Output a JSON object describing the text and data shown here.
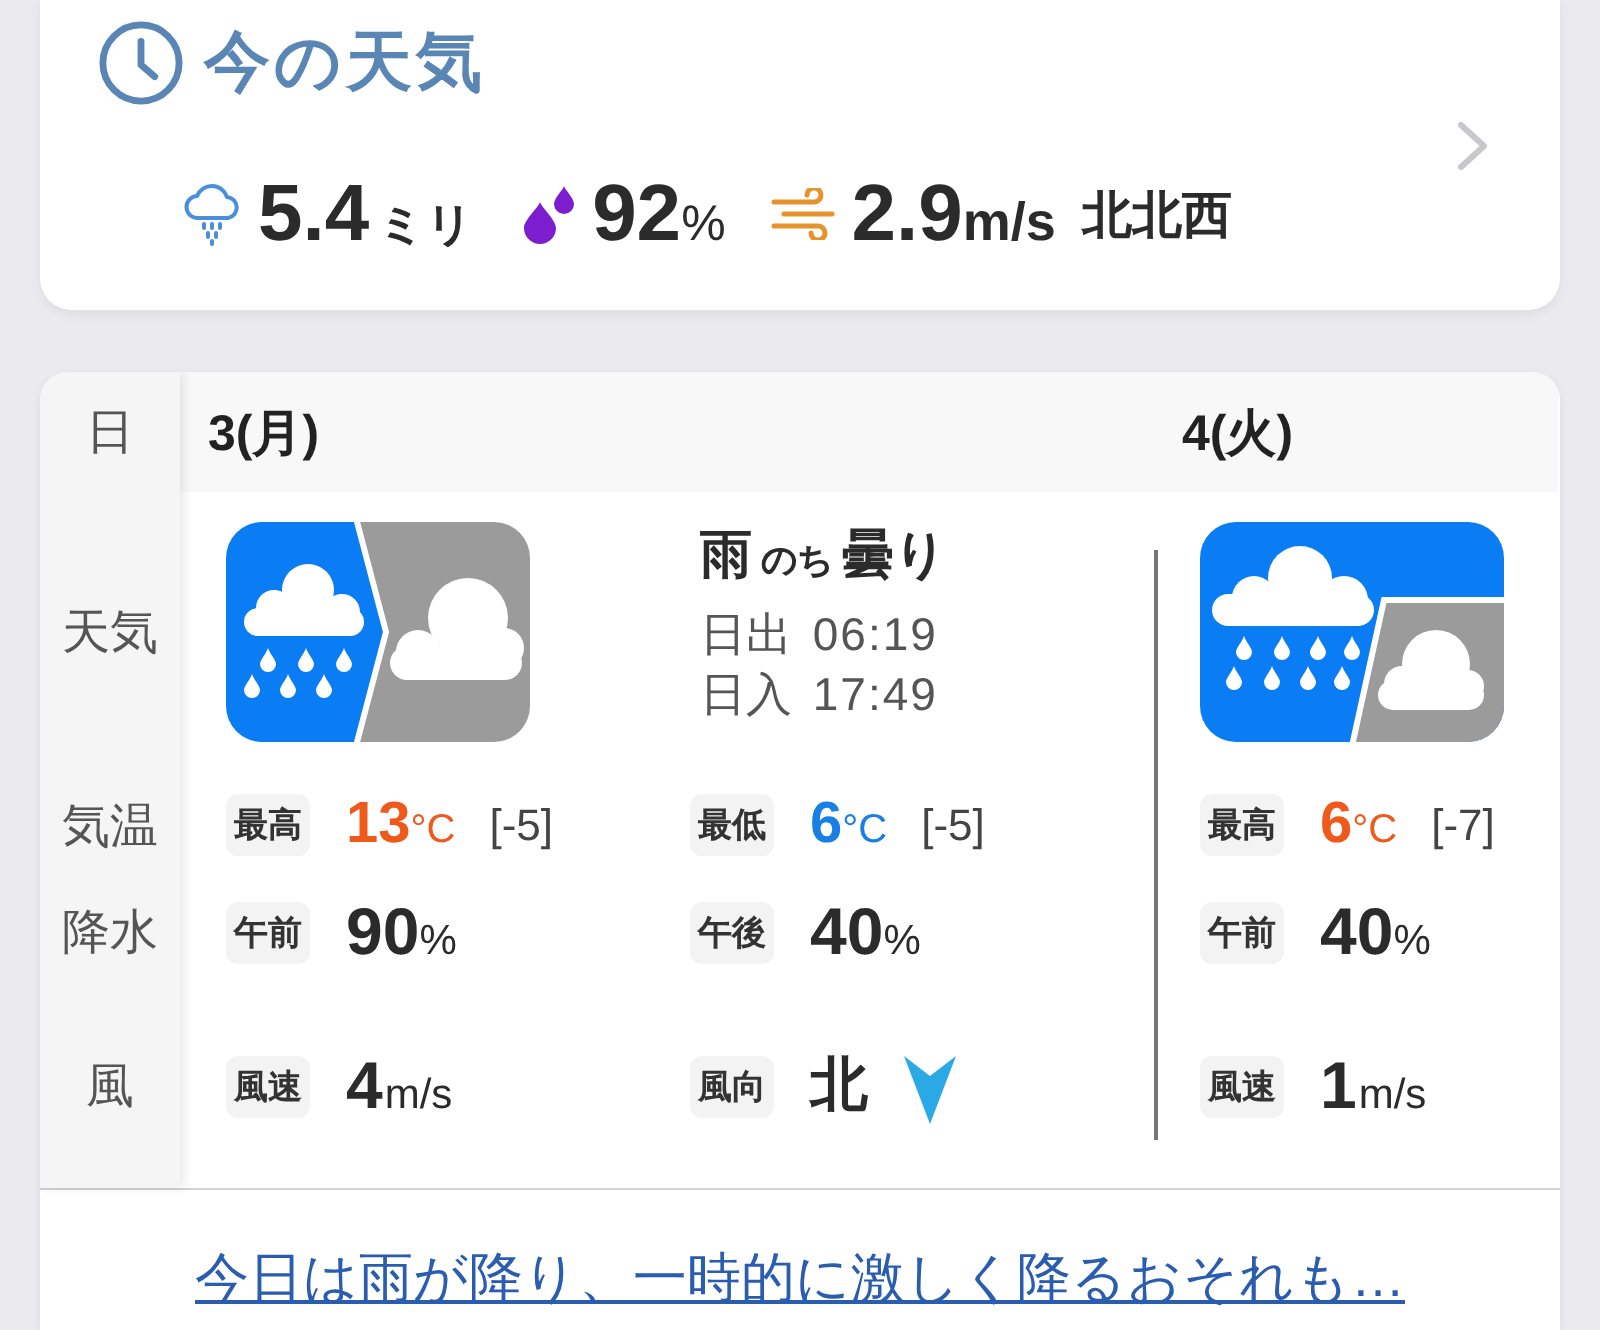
{
  "current_weather": {
    "title": "今の天気",
    "readings": [
      {
        "kind": "rain",
        "value": "5.4",
        "unit": "ミリ"
      },
      {
        "kind": "humidity",
        "value": "92",
        "unit": "%"
      },
      {
        "kind": "wind",
        "value": "2.9",
        "unit": "m/s",
        "direction": "北北西"
      }
    ]
  },
  "forecast": {
    "row_labels": [
      "日",
      "天気",
      "気温",
      "降水",
      "風"
    ],
    "days": [
      {
        "date": "3(月)",
        "kind": "rain_then_cloudy",
        "summary": [
          "雨",
          "のち",
          "曇り"
        ],
        "sun": [
          {
            "label": "日出",
            "time": "06:19"
          },
          {
            "label": "日入",
            "time": "17:49"
          }
        ],
        "temperature": [
          {
            "kind": "high",
            "label": "最高",
            "value": "13",
            "unit": "°C",
            "change": "[-5]"
          },
          {
            "kind": "low",
            "label": "最低",
            "value": "6",
            "unit": "°C",
            "change": "[-5]"
          }
        ],
        "precipitation": [
          {
            "label": "午前",
            "value": "90",
            "unit": "%"
          },
          {
            "label": "午後",
            "value": "40",
            "unit": "%"
          }
        ],
        "wind": [
          {
            "kind": "speed",
            "label": "風速",
            "value": "4",
            "unit": "m/s"
          },
          {
            "kind": "direction",
            "label": "風向",
            "value": "北"
          }
        ]
      },
      {
        "date": "4(火)",
        "kind": "rain_partly_cloudy",
        "temperature": [
          {
            "kind": "high",
            "label": "最高",
            "value": "6",
            "unit": "°C",
            "change": "[-7]"
          }
        ],
        "precipitation": [
          {
            "label": "午前",
            "value": "40",
            "unit": "%"
          }
        ],
        "wind": [
          {
            "kind": "speed",
            "label": "風速",
            "value": "1",
            "unit": "m/s"
          }
        ]
      }
    ],
    "summary_link": "今日は雨が降り、一時的に激しく降るおそれも…"
  }
}
